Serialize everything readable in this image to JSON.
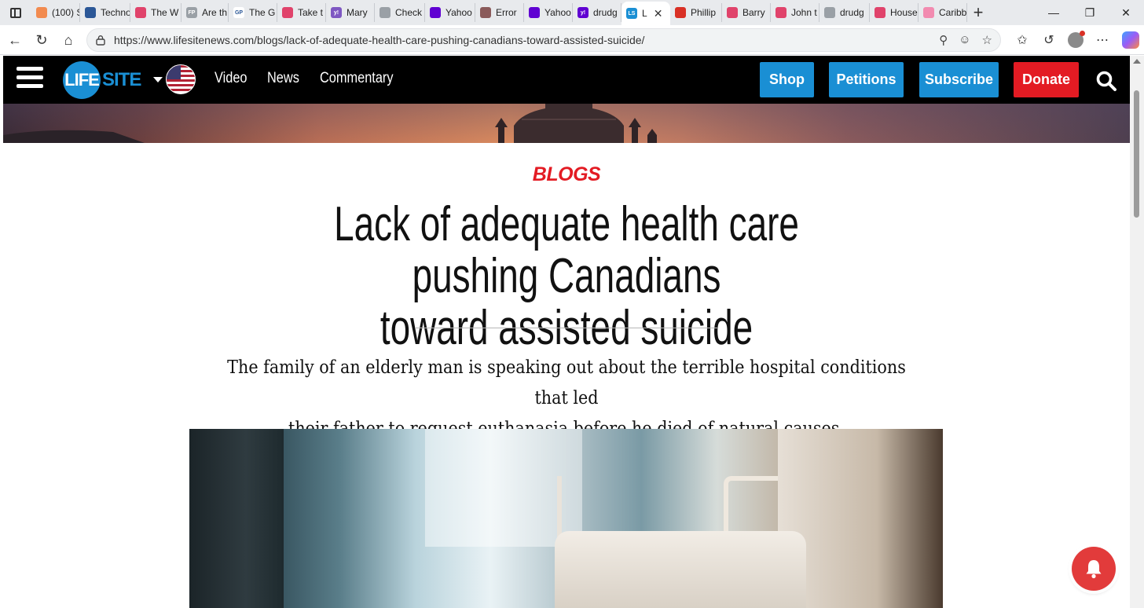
{
  "browser": {
    "tabs": [
      {
        "label": "(100) S",
        "color": "#f28b50"
      },
      {
        "label": "Techno",
        "color": "#2b5797"
      },
      {
        "label": "The W",
        "color": "#e0436b"
      },
      {
        "label": "Are th",
        "color": "#9aa0a6",
        "glyph": "FP"
      },
      {
        "label": "The G",
        "color": "#ffffff",
        "glyph": "GP"
      },
      {
        "label": "Take t",
        "color": "#e0436b"
      },
      {
        "label": "Mary",
        "color": "#7e57c2",
        "glyph": "y!"
      },
      {
        "label": "Check",
        "color": "#9aa0a6"
      },
      {
        "label": "Yahoo",
        "color": "#6001d2"
      },
      {
        "label": "Error",
        "color": "#8a5a5a"
      },
      {
        "label": "Yahoo",
        "color": "#6001d2"
      },
      {
        "label": "drudg",
        "color": "#6001d2",
        "glyph": "y!"
      },
      {
        "label": "L",
        "color": "#1a8fd4",
        "glyph": "LS",
        "active": true
      },
      {
        "label": "Phillip",
        "color": "#d93025"
      },
      {
        "label": "Barry",
        "color": "#e0436b"
      },
      {
        "label": "John t",
        "color": "#e0436b"
      },
      {
        "label": "drudg",
        "color": "#9aa0a6"
      },
      {
        "label": "House",
        "color": "#e0436b"
      },
      {
        "label": "Caribb",
        "color": "#f28bb0"
      }
    ],
    "new_tab": "+",
    "url": "https://www.lifesitenews.com/blogs/lack-of-adequate-health-care-pushing-canadians-toward-assisted-suicide/"
  },
  "site": {
    "logo_mark": "LIFE",
    "logo_text": "SITE",
    "nav_links": [
      "Video",
      "News",
      "Commentary"
    ],
    "buttons": {
      "shop": "Shop",
      "petitions": "Petitions",
      "subscribe": "Subscribe",
      "donate": "Donate"
    },
    "colors": {
      "brand_blue": "#1a8fd4",
      "donate_red": "#e31b23",
      "nav_bg": "#000000"
    }
  },
  "article": {
    "kicker": "BLOGS",
    "title_line1": "Lack of adequate health care pushing Canadians",
    "title_line2": "toward assisted suicide",
    "dek_line1": "The family of an elderly man is speaking out about the terrible hospital conditions that led",
    "dek_line2": "their father to request euthanasia before he died of natural causes."
  },
  "icons": {
    "menu": "hamburger-icon",
    "search": "search-icon",
    "bell": "notification-bell-icon",
    "flag": "us-flag-icon"
  }
}
